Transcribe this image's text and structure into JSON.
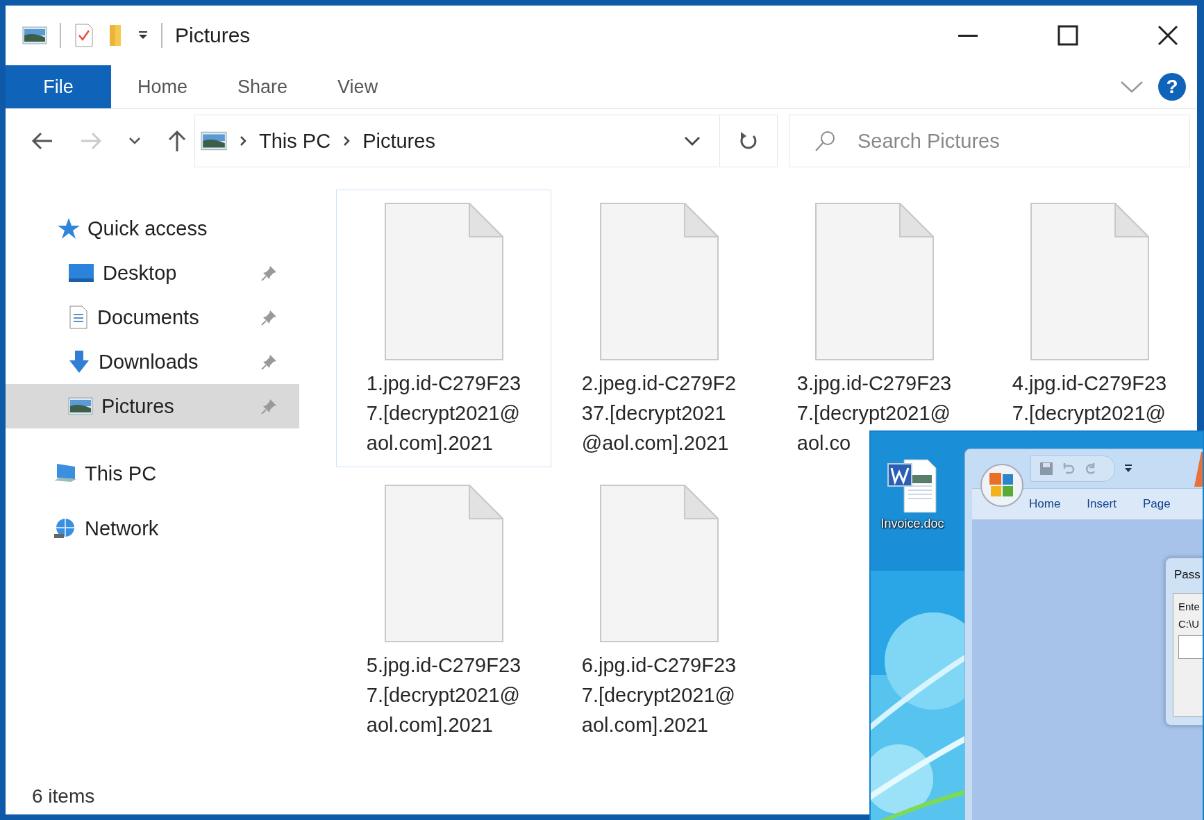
{
  "window": {
    "title": "Pictures"
  },
  "ribbon_tabs": [
    {
      "label": "File",
      "selected": true
    },
    {
      "label": "Home",
      "selected": false
    },
    {
      "label": "Share",
      "selected": false
    },
    {
      "label": "View",
      "selected": false
    }
  ],
  "help": "?",
  "address": {
    "path": [
      "This PC",
      "Pictures"
    ]
  },
  "search": {
    "placeholder": "Search Pictures"
  },
  "sidebar": {
    "items": [
      {
        "label": "Quick access",
        "kind": "star",
        "selected": false,
        "children": [
          {
            "label": "Desktop",
            "kind": "desktop",
            "pinned": true,
            "selected": false
          },
          {
            "label": "Documents",
            "kind": "documents",
            "pinned": true,
            "selected": false
          },
          {
            "label": "Downloads",
            "kind": "downloads",
            "pinned": true,
            "selected": false
          },
          {
            "label": "Pictures",
            "kind": "pictures",
            "pinned": true,
            "selected": true
          }
        ]
      },
      {
        "label": "This PC",
        "kind": "pc",
        "selected": false
      },
      {
        "label": "Network",
        "kind": "network",
        "selected": false
      }
    ]
  },
  "files": [
    {
      "lines": [
        "1.jpg.id-C279F23",
        "7.[decrypt2021@",
        "aol.com].2021"
      ],
      "selected": true
    },
    {
      "lines": [
        "2.jpeg.id-C279F2",
        "37.[decrypt2021",
        "@aol.com].2021"
      ],
      "selected": false
    },
    {
      "lines": [
        "3.jpg.id-C279F23",
        "7.[decrypt2021@",
        "aol.co"
      ],
      "selected": false
    },
    {
      "lines": [
        "4.jpg.id-C279F23",
        "7.[decrypt2021@"
      ],
      "selected": false
    },
    {
      "lines": [
        "5.jpg.id-C279F23",
        "7.[decrypt2021@",
        "aol.com].2021"
      ],
      "selected": false
    },
    {
      "lines": [
        "6.jpg.id-C279F23",
        "7.[decrypt2021@",
        "aol.com].2021"
      ],
      "selected": false
    }
  ],
  "status_bar": {
    "count": "6 items"
  },
  "inset": {
    "desktop_icon": "Invoice.doc",
    "word_tabs": [
      "Home",
      "Insert",
      "Page"
    ],
    "dialog": {
      "title": "Pass",
      "lines": [
        "Ente",
        "C:\\U"
      ]
    }
  }
}
